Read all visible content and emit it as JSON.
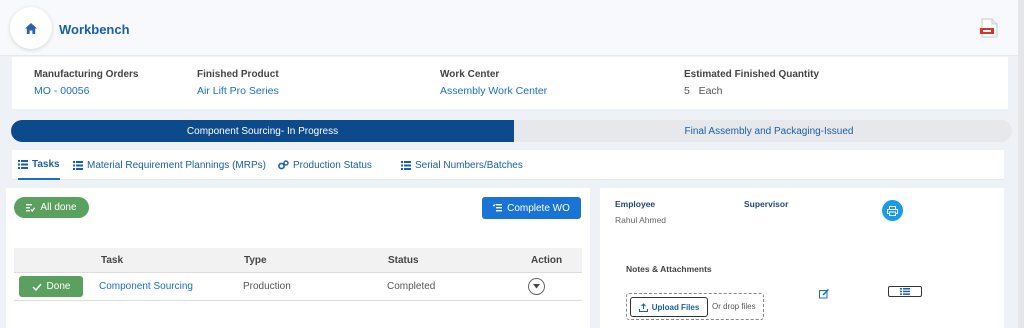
{
  "header": {
    "title": "Workbench"
  },
  "info": [
    {
      "label": "Manufacturing Orders",
      "value": "MO - 00056"
    },
    {
      "label": "Finished Product",
      "value": "Air Lift Pro Series"
    },
    {
      "label": "Work Center",
      "value": "Assembly Work Center"
    },
    {
      "label": "Estimated Finished Quantity",
      "value": "5   Each"
    }
  ],
  "stepper": {
    "active": "Component Sourcing- In Progress",
    "next": "Final Assembly and Packaging-Issued"
  },
  "tabs": [
    {
      "label": "Tasks",
      "icon": "list-icon",
      "active": true
    },
    {
      "label": "Material Requirement Plannings (MRPs)",
      "icon": "list-icon"
    },
    {
      "label": "Production Status",
      "icon": "gears-icon"
    },
    {
      "label": "Serial Numbers/Batches",
      "icon": "list-icon"
    }
  ],
  "tasks": {
    "all_done_label": "All done",
    "complete_wo_label": "Complete WO",
    "columns": [
      "Task",
      "Type",
      "Status",
      "Action"
    ],
    "rows": [
      {
        "button": "Done",
        "task": "Component Sourcing",
        "type": "Production",
        "status": "Completed"
      }
    ]
  },
  "right_panel": {
    "employee_label": "Employee",
    "employee_value": "Rahul Ahmed",
    "supervisor_label": "Supervisor",
    "notes_label": "Notes & Attachments",
    "upload_label": "Upload Files",
    "drop_label": "Or drop files"
  },
  "colors": {
    "primary": "#1a73d6",
    "dark_blue": "#0d4a8c",
    "success": "#5aa05f",
    "link": "#1a6fc4"
  }
}
